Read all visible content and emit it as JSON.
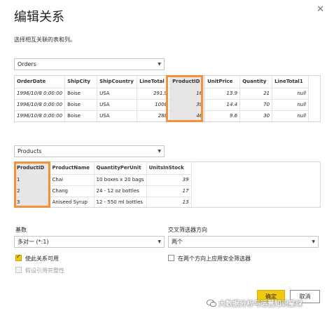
{
  "dialog": {
    "title": "编辑关系",
    "subtitle": "选择相互关联的表和列。",
    "close_icon": "close-icon"
  },
  "table1": {
    "selected": "Orders",
    "columns": [
      "OrderDate",
      "ShipCity",
      "ShipCountry",
      "LineTotal",
      "ProductID",
      "UnitPrice",
      "Quantity",
      "LineTotal1"
    ],
    "selected_column": "ProductID",
    "rows": [
      [
        "1996/10/8 0:00:00",
        "Boise",
        "USA",
        "291.9",
        "16",
        "13.9",
        "21",
        "null"
      ],
      [
        "1996/10/8 0:00:00",
        "Boise",
        "USA",
        "1008",
        "39",
        "14.4",
        "70",
        "null"
      ],
      [
        "1996/10/8 0:00:00",
        "Boise",
        "USA",
        "288",
        "46",
        "9.6",
        "30",
        "null"
      ]
    ]
  },
  "table2": {
    "selected": "Products",
    "columns": [
      "ProductID",
      "ProductName",
      "QuantityPerUnit",
      "UnitsInStock"
    ],
    "selected_column": "ProductID",
    "rows": [
      [
        "1",
        "Chai",
        "10 boxes x 20 bags",
        "39"
      ],
      [
        "2",
        "Chang",
        "24 - 12 oz bottles",
        "17"
      ],
      [
        "3",
        "Aniseed Syrup",
        "12 - 550 ml bottles",
        "13"
      ]
    ]
  },
  "cardinality": {
    "label": "基数",
    "value": "多对一 (*:1)"
  },
  "cross_filter": {
    "label": "交叉筛选器方向",
    "value": "两个"
  },
  "options": {
    "active": {
      "label": "使此关系可用",
      "checked": true
    },
    "security_filter": {
      "label": "在两个方向上应用安全筛选器",
      "checked": false
    },
    "referential_integrity": {
      "label": "假设引用完整性",
      "checked": false,
      "disabled": true
    }
  },
  "buttons": {
    "ok": "确定",
    "cancel": "取消"
  },
  "watermark": "大数据分析与运营知识星球",
  "colors": {
    "accent": "#f2c811",
    "highlight": "#f0933a"
  }
}
